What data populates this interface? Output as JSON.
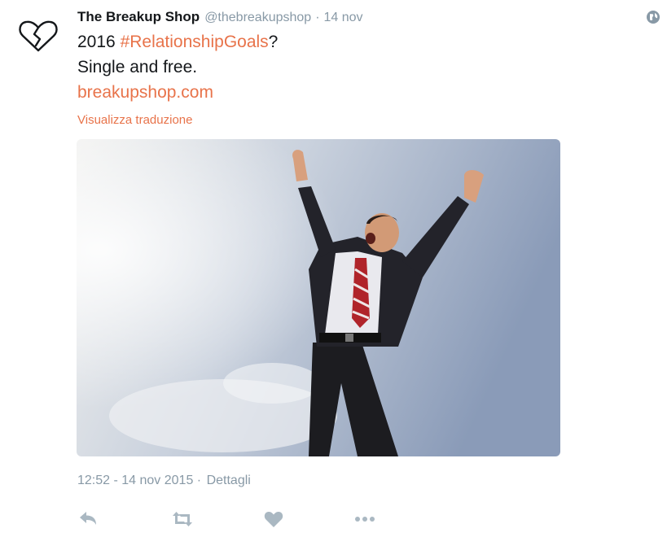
{
  "tweet": {
    "author_name": "The Breakup Shop",
    "author_handle": "@thebreakupshop",
    "separator": "·",
    "date_short": "14 nov",
    "text": {
      "line1_prefix": "2016 ",
      "hashtag": "#RelationshipGoals",
      "line1_suffix": "?",
      "line2": "Single and free.",
      "link": "breakupshop.com"
    },
    "translate_label": "Visualizza traduzione",
    "timestamp": "12:52 - 14 nov 2015",
    "details_label": "Dettagli"
  },
  "icons": {
    "avatar": "broken-heart-icon",
    "globe": "globe-icon",
    "reply": "reply-icon",
    "retweet": "retweet-icon",
    "like": "heart-icon",
    "more": "more-icon"
  },
  "colors": {
    "accent": "#e8734a",
    "muted": "#8899a6",
    "text": "#14171a",
    "action_icon": "#aab8c2"
  }
}
